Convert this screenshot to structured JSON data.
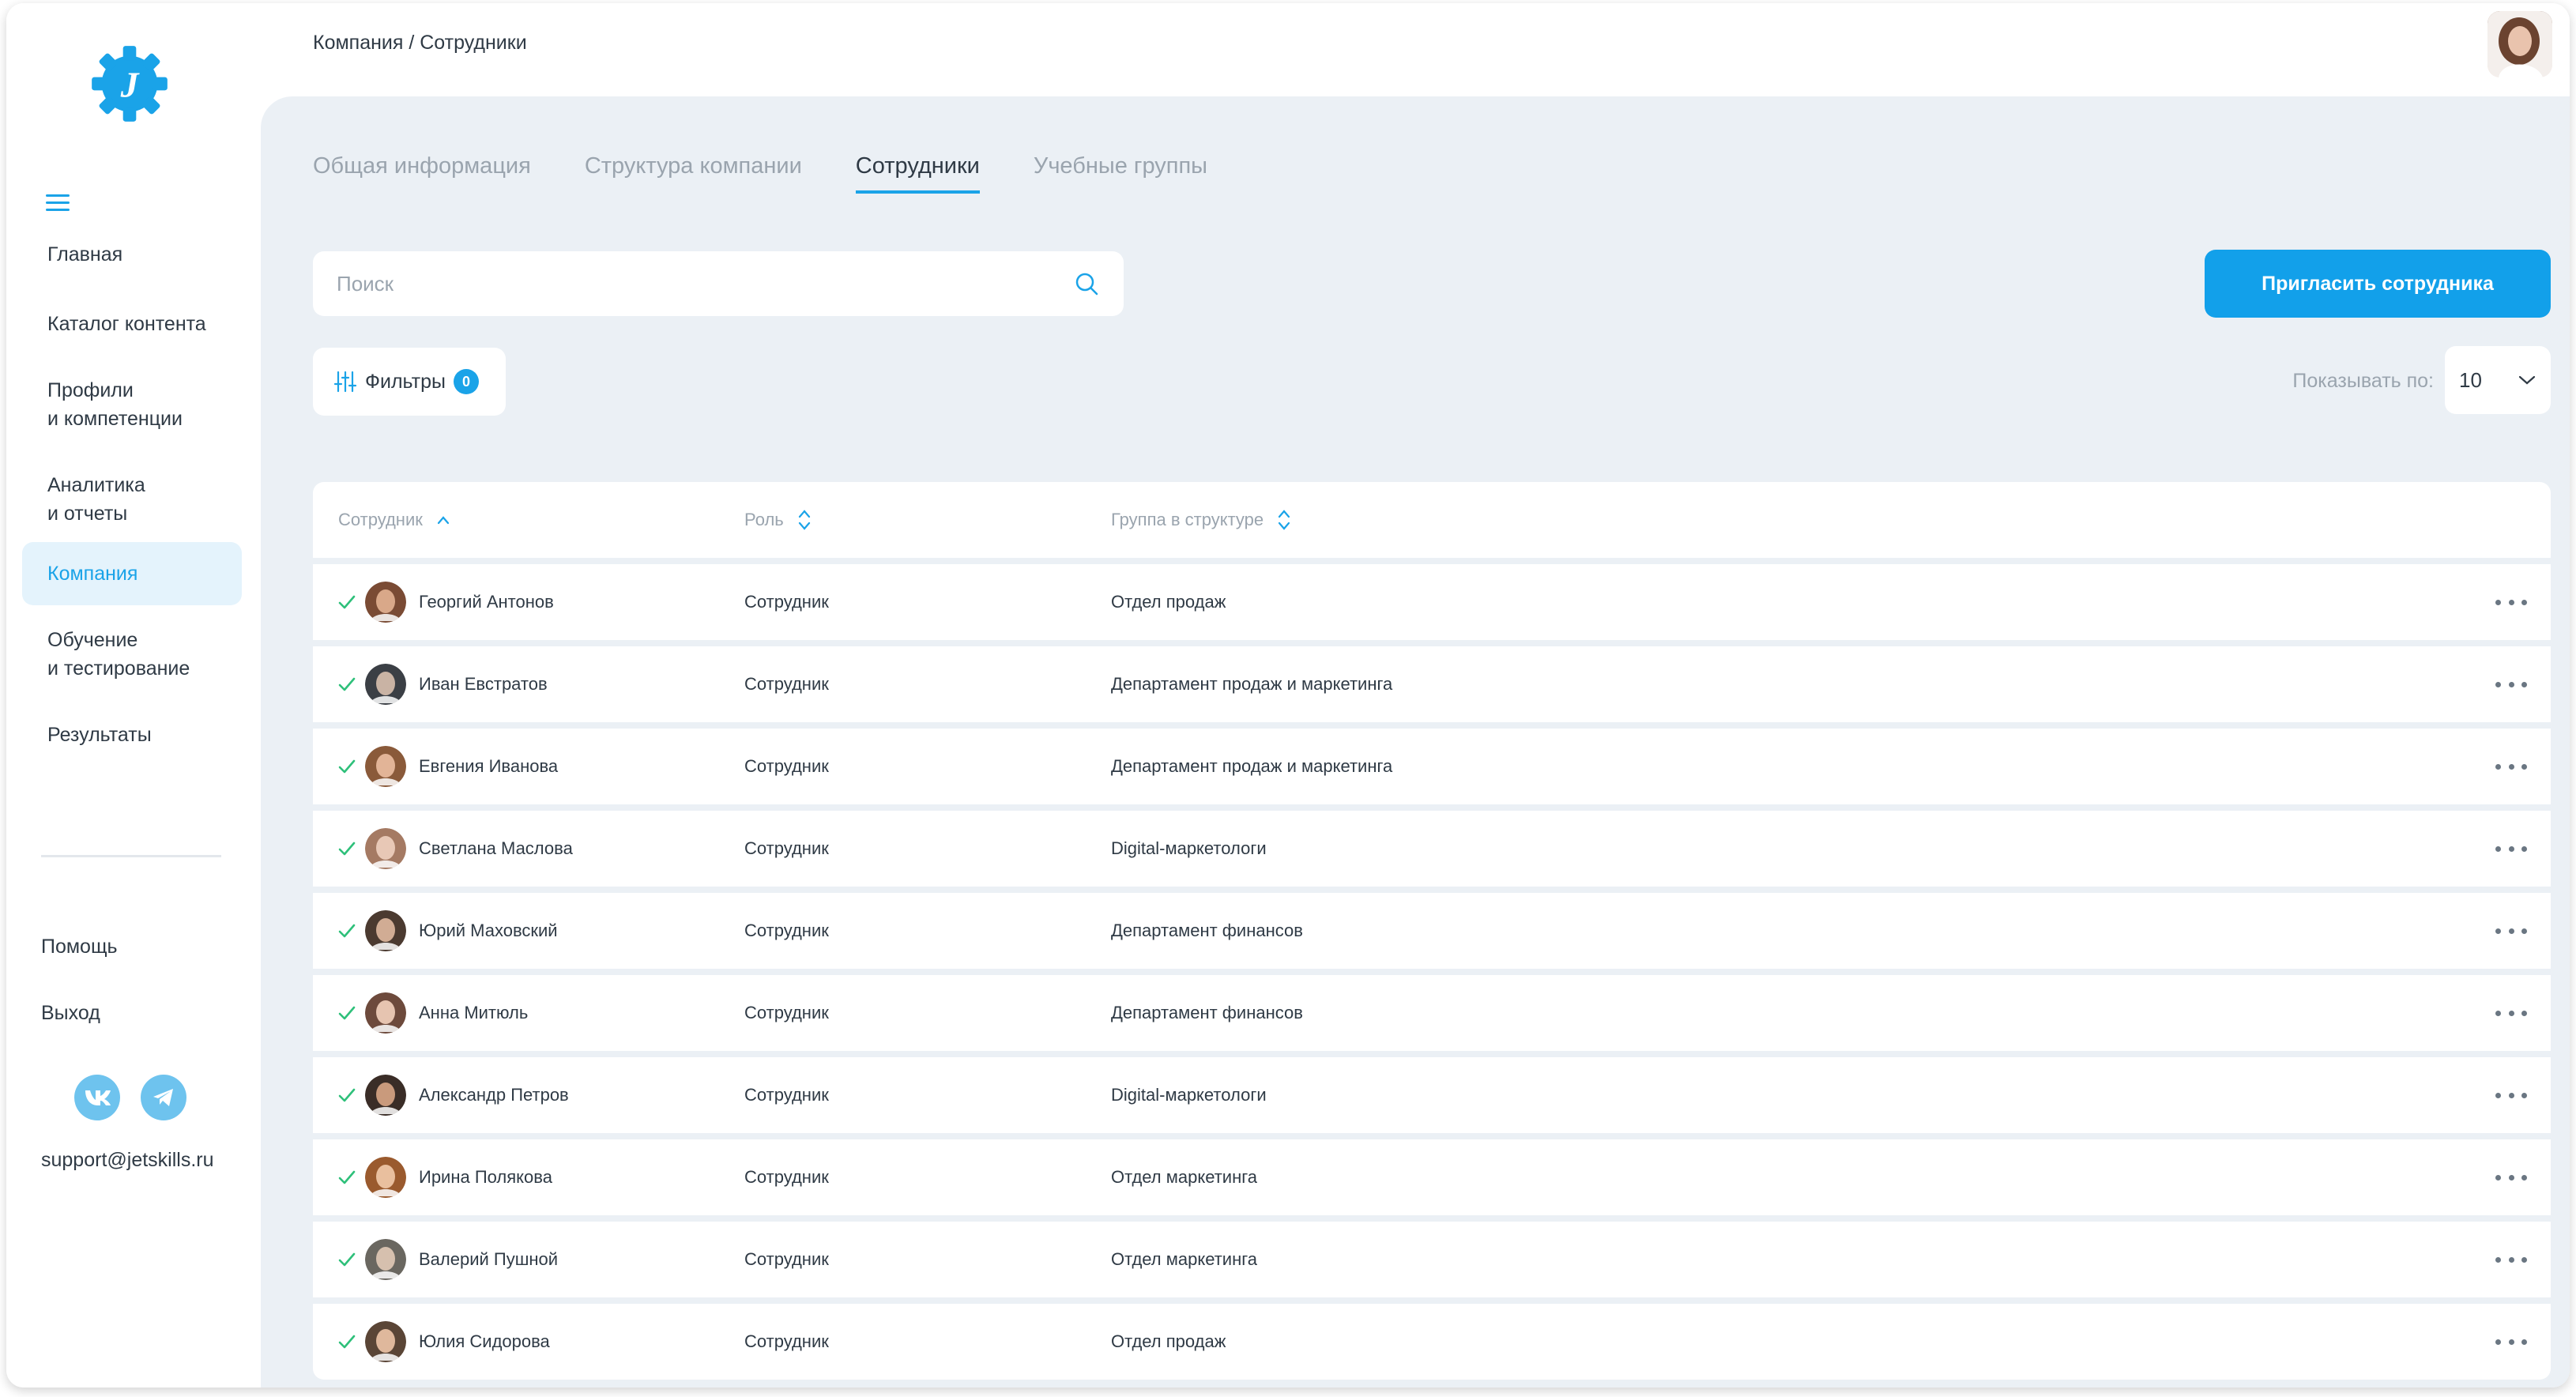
{
  "sidebar": {
    "logo_letter": "J",
    "items": [
      {
        "label": "Главная",
        "line2": ""
      },
      {
        "label": "Каталог контента",
        "line2": ""
      },
      {
        "label": "Профили",
        "line2": "и компетенции"
      },
      {
        "label": "Аналитика",
        "line2": "и отчеты"
      },
      {
        "label": "Компания",
        "line2": ""
      },
      {
        "label": "Обучение",
        "line2": "и тестирование"
      },
      {
        "label": "Результаты",
        "line2": ""
      }
    ],
    "help": "Помощь",
    "logout": "Выход",
    "support_email": "support@jetskills.ru",
    "social": [
      "vk-icon",
      "telegram-icon"
    ]
  },
  "header": {
    "breadcrumb": "Компания / Сотрудники"
  },
  "tabs": [
    {
      "label": "Общая информация",
      "active": false
    },
    {
      "label": "Структура компании",
      "active": false
    },
    {
      "label": "Сотрудники",
      "active": true
    },
    {
      "label": "Учебные группы",
      "active": false
    }
  ],
  "search": {
    "placeholder": "Поиск"
  },
  "invite_button": "Пригласить сотрудника",
  "filters": {
    "label": "Фильтры",
    "count": "0"
  },
  "pager": {
    "label": "Показывать по:",
    "value": "10"
  },
  "table": {
    "columns": [
      "Сотрудник",
      "Роль",
      "Группа в структуре"
    ],
    "rows": [
      {
        "name": "Георгий Антонов",
        "role": "Сотрудник",
        "group": "Отдел продаж"
      },
      {
        "name": "Иван Евстратов",
        "role": "Сотрудник",
        "group": "Департамент продаж и маркетинга"
      },
      {
        "name": "Евгения Иванова",
        "role": "Сотрудник",
        "group": "Департамент продаж и маркетинга"
      },
      {
        "name": "Светлана Маслова",
        "role": "Сотрудник",
        "group": "Digital-маркетологи"
      },
      {
        "name": "Юрий Маховский",
        "role": "Сотрудник",
        "group": "Департамент финансов"
      },
      {
        "name": "Анна Митюль",
        "role": "Сотрудник",
        "group": "Департамент финансов"
      },
      {
        "name": "Александр Петров",
        "role": "Сотрудник",
        "group": "Digital-маркетологи"
      },
      {
        "name": "Ирина Полякова",
        "role": "Сотрудник",
        "group": "Отдел маркетинга"
      },
      {
        "name": "Валерий Пушной",
        "role": "Сотрудник",
        "group": "Отдел маркетинга"
      },
      {
        "name": "Юлия Сидорова",
        "role": "Сотрудник",
        "group": "Отдел продаж"
      }
    ]
  },
  "colors": {
    "accent": "#1aa3e8",
    "check": "#2ec07a",
    "background": "#ebf0f5"
  }
}
